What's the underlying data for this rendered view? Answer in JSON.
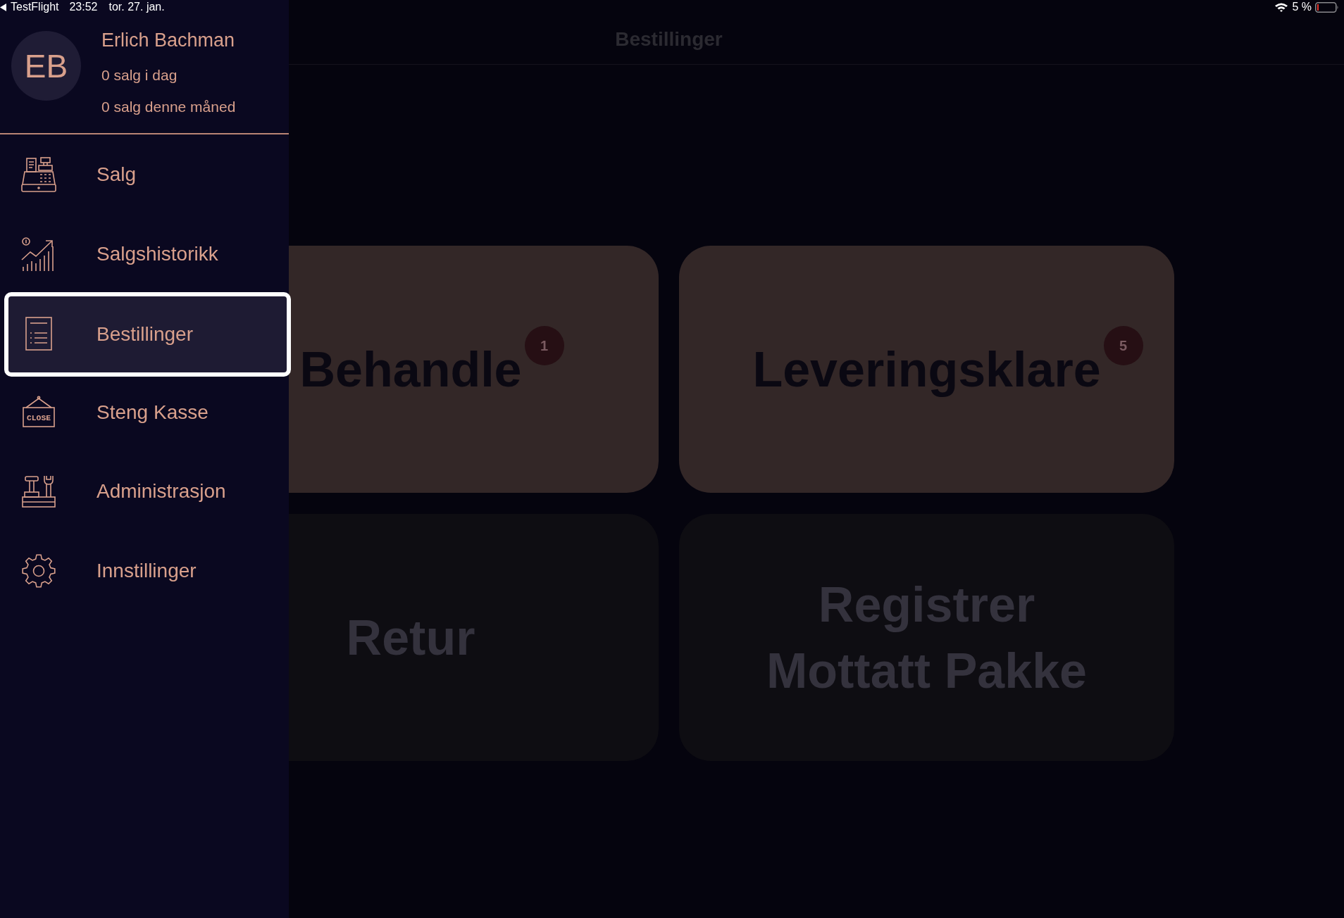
{
  "status_bar": {
    "back_label": "TestFlight",
    "time": "23:52",
    "date": "tor. 27. jan.",
    "battery": "5 %"
  },
  "drawer": {
    "profile": {
      "initials": "EB",
      "name": "Erlich Bachman",
      "stats": [
        "0 salg i dag",
        "0 salg denne måned"
      ]
    },
    "items": [
      {
        "label": "Salg",
        "selected": false
      },
      {
        "label": "Salgshistorikk",
        "selected": false
      },
      {
        "label": "Bestillinger",
        "selected": true
      },
      {
        "label": "Steng Kasse",
        "selected": false,
        "icon_text": "CLOSE"
      },
      {
        "label": "Administrasjon",
        "selected": false
      },
      {
        "label": "Innstillinger",
        "selected": false
      }
    ]
  },
  "header": {
    "title": "Bestillinger"
  },
  "cards": [
    {
      "label": "Behandle",
      "badge": "1",
      "disabled": false
    },
    {
      "label": "Leveringsklare",
      "badge": "5",
      "disabled": false
    },
    {
      "label": "Retur",
      "disabled": true
    },
    {
      "label": "Registrer Mottatt Pakke",
      "disabled": true
    }
  ]
}
